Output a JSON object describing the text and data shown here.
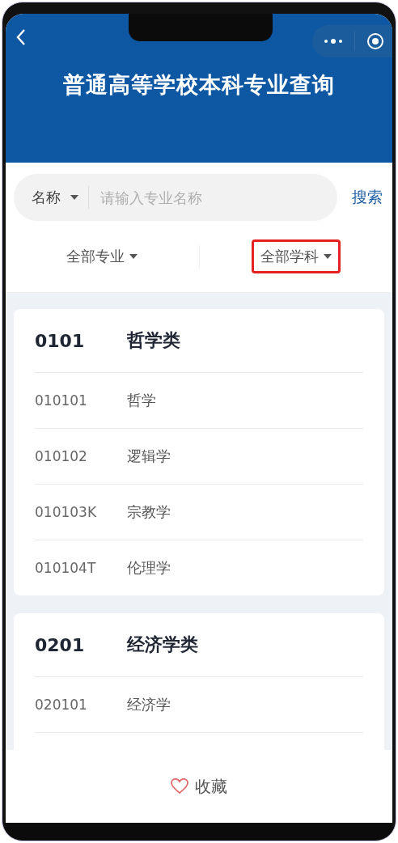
{
  "header": {
    "title": "普通高等学校本科专业查询"
  },
  "search": {
    "scope": "名称",
    "placeholder": "请输入专业名称",
    "button": "搜索"
  },
  "filters": [
    {
      "label": "全部专业",
      "highlighted": false
    },
    {
      "label": "全部学科",
      "highlighted": true
    }
  ],
  "groups": [
    {
      "code": "0101",
      "name": "哲学类",
      "majors": [
        {
          "code": "010101",
          "name": "哲学"
        },
        {
          "code": "010102",
          "name": "逻辑学"
        },
        {
          "code": "010103K",
          "name": "宗教学"
        },
        {
          "code": "010104T",
          "name": "伦理学"
        }
      ]
    },
    {
      "code": "0201",
      "name": "经济学类",
      "majors": [
        {
          "code": "020101",
          "name": "经济学"
        }
      ]
    }
  ],
  "footer": {
    "favorite": "收藏"
  }
}
